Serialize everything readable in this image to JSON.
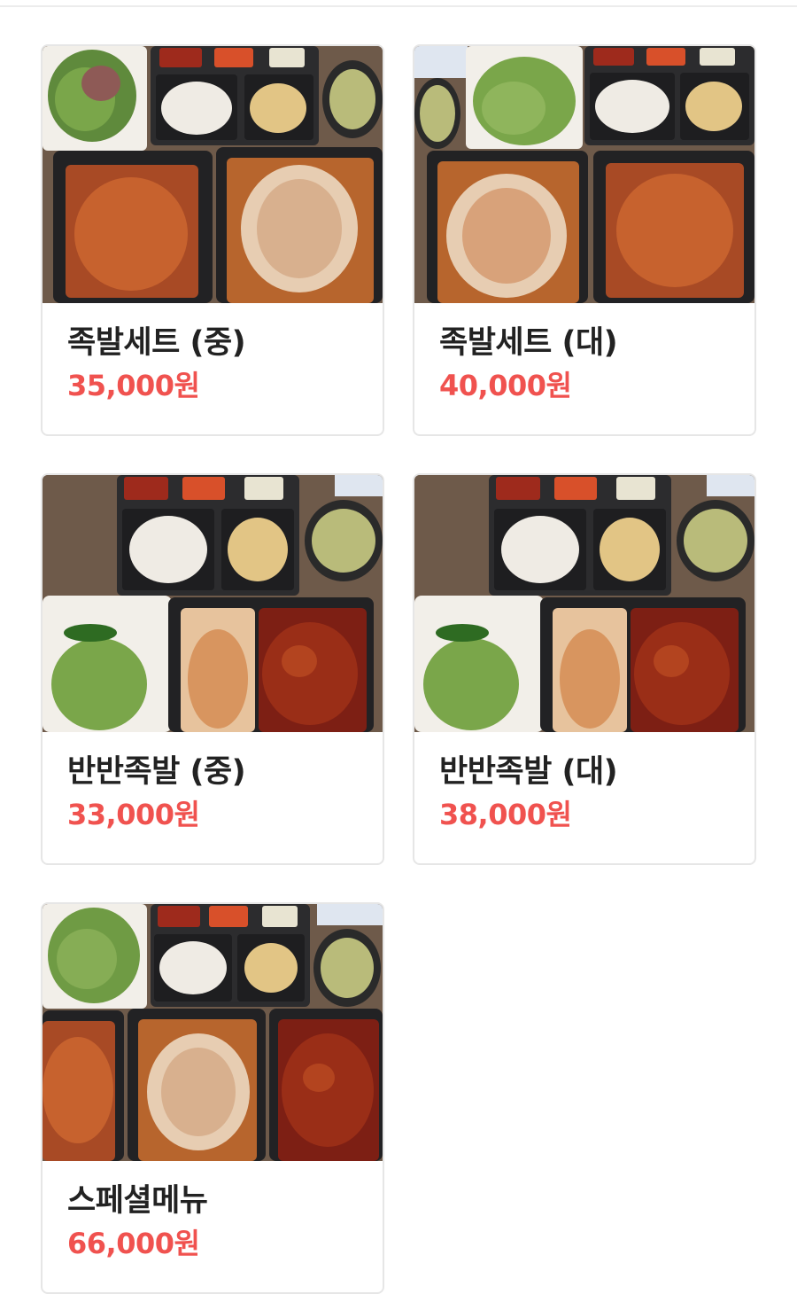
{
  "colors": {
    "name_text": "#222222",
    "price_text": "#f0524f",
    "card_border": "#e6e6e6"
  },
  "menu_items": [
    {
      "name": "족발세트 (중)",
      "price": "35,000원",
      "photo": "set-photo"
    },
    {
      "name": "족발세트 (대)",
      "price": "40,000원",
      "photo": "set-photo-alt"
    },
    {
      "name": "반반족발 (중)",
      "price": "33,000원",
      "photo": "half-photo"
    },
    {
      "name": "반반족발 (대)",
      "price": "38,000원",
      "photo": "half-photo"
    },
    {
      "name": "스페셜메뉴",
      "price": "66,000원",
      "photo": "special-photo"
    }
  ]
}
